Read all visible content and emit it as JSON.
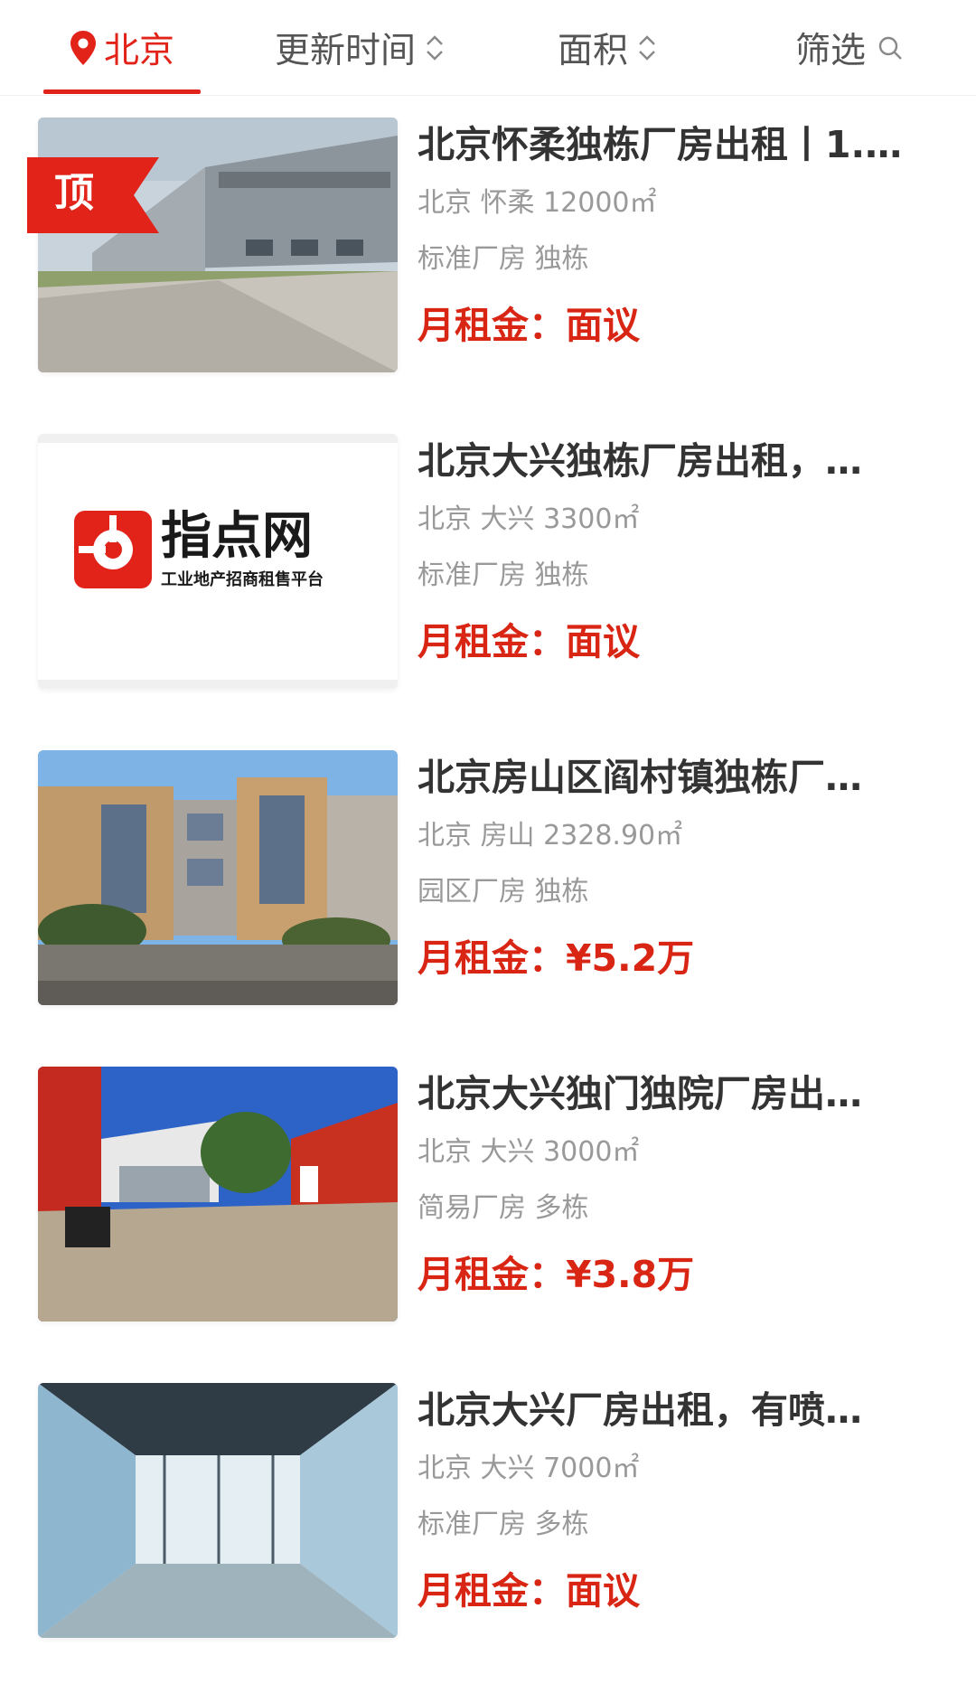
{
  "header": {
    "city": "北京",
    "sort_update": "更新时间",
    "sort_area": "面积",
    "filter": "筛选",
    "accent_color": "#e2231a"
  },
  "listings": [
    {
      "title": "北京怀柔独栋厂房出租丨1.…",
      "location": "北京 怀柔 12000㎡",
      "tags": "标准厂房 独栋",
      "price_label": "月租金：",
      "price_value": "面议",
      "badge": "顶",
      "image": "grey-steel-warehouse-photo"
    },
    {
      "title": "北京大兴独栋厂房出租，…",
      "location": "北京 大兴 3300㎡",
      "tags": "标准厂房 独栋",
      "price_label": "月租金：",
      "price_value": "面议",
      "image": "zhidianwang-logo",
      "logo_name": "指点网",
      "logo_subtitle": "工业地产招商租售平台"
    },
    {
      "title": "北京房山区阎村镇独栋厂…",
      "location": "北京 房山 2328.90㎡",
      "tags": "园区厂房 独栋",
      "price_label": "月租金：",
      "price_value": "¥5.2万",
      "image": "tan-office-building-photo"
    },
    {
      "title": "北京大兴独门独院厂房出…",
      "location": "北京 大兴 3000㎡",
      "tags": "简易厂房 多栋",
      "price_label": "月租金：",
      "price_value": "¥3.8万",
      "image": "red-walled-courtyard-photo"
    },
    {
      "title": "北京大兴厂房出租，有喷…",
      "location": "北京 大兴 7000㎡",
      "tags": "标准厂房 多栋",
      "price_label": "月租金：",
      "price_value": "面议",
      "image": "warehouse-interior-photo"
    }
  ]
}
